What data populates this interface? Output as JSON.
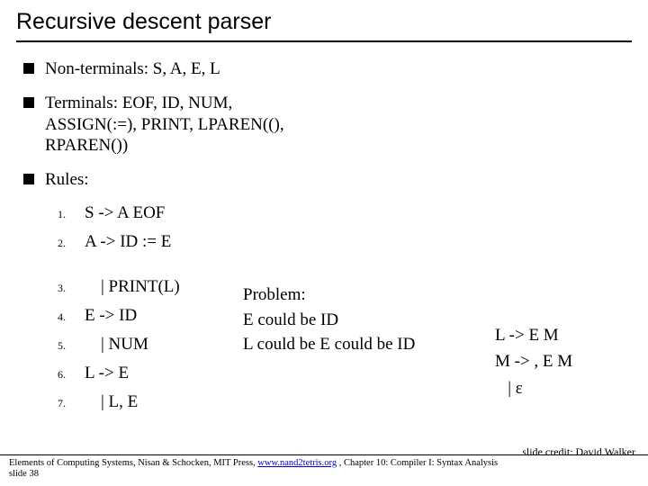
{
  "title": "Recursive descent parser",
  "bullets": {
    "nonterminals": "Non-terminals: S, A, E, L",
    "terminals": "Terminals: EOF, ID, NUM, ASSIGN(:=), PRINT, LPAREN((), RPAREN())",
    "rules_label": "Rules:"
  },
  "rules": {
    "r1": {
      "n": "1.",
      "t": "S -> A EOF"
    },
    "r2": {
      "n": "2.",
      "t": "A -> ID := E"
    },
    "r3": {
      "n": "3.",
      "t": "| PRINT(L)"
    },
    "r4": {
      "n": "4.",
      "t": "E -> ID"
    },
    "r5": {
      "n": "5.",
      "t": "| NUM"
    },
    "r6": {
      "n": "6.",
      "t": "L -> E"
    },
    "r7": {
      "n": "7.",
      "t": "| L, E"
    }
  },
  "problem": {
    "line1": "Problem:",
    "line2": "E could be ID",
    "line3": "L could be E could be ID"
  },
  "right": {
    "line1": "L -> E M",
    "line2": "M -> , E M",
    "line3": "   | ε"
  },
  "credit": "slide credit: David Walker",
  "footer": {
    "prefix": "Elements of Computing Systems, Nisan & Schocken, MIT Press, ",
    "link": "www.nand2tetris.org",
    "suffix": " , Chapter 10: Compiler I: Syntax Analysis",
    "slidenum": "slide 38"
  }
}
